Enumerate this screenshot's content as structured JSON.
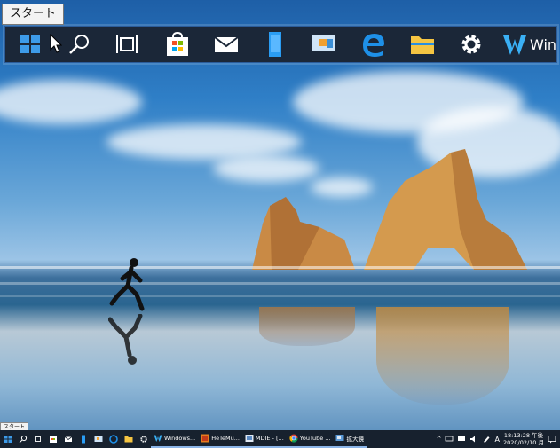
{
  "zoom_tooltip": "スタート",
  "taskbar_tooltip": "スタート",
  "zoom_strip": {
    "wide_label": "Win"
  },
  "taskbar": {
    "apps": [
      {
        "key": "windows",
        "label": "Windows..."
      },
      {
        "key": "hetemu",
        "label": "HeTeMu..."
      },
      {
        "key": "mdie",
        "label": "MDIE - [..."
      },
      {
        "key": "youtube",
        "label": "YouTube ..."
      },
      {
        "key": "magnifier",
        "label": "拡大鏡"
      }
    ],
    "ime": "A",
    "time": "18:13:28 午後",
    "date": "2020/02/10 月"
  },
  "colors": {
    "taskbar_bg": "#17212e",
    "accent": "#8ab4e8",
    "store_red": "#f25022",
    "store_green": "#7fba00",
    "store_blue": "#00a4ef",
    "store_yellow": "#ffb900"
  }
}
